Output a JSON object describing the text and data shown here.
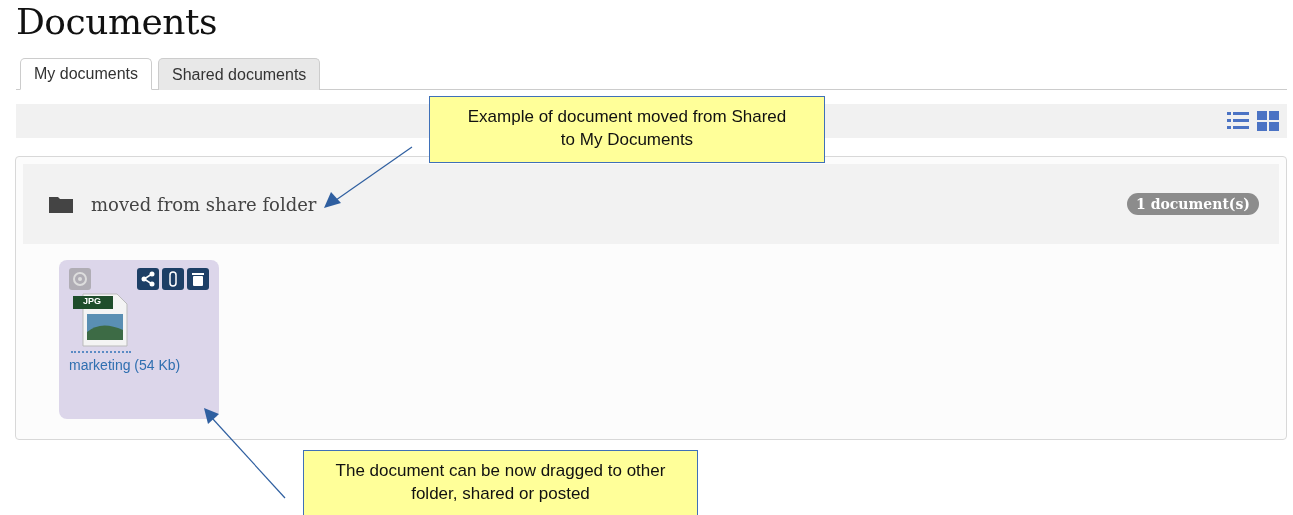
{
  "title": "Documents",
  "tabs": [
    {
      "label": "My documents",
      "selected": true
    },
    {
      "label": "Shared documents",
      "selected": false
    }
  ],
  "folder": {
    "name": "moved from share folder",
    "count": "1 document(s)",
    "documents": [
      {
        "type": "JPG",
        "name": "marketing (54 Kb)"
      }
    ]
  },
  "callouts": [
    "Example of document moved from Shared to My Documents",
    "The document can be now dragged to other folder, shared or posted"
  ]
}
